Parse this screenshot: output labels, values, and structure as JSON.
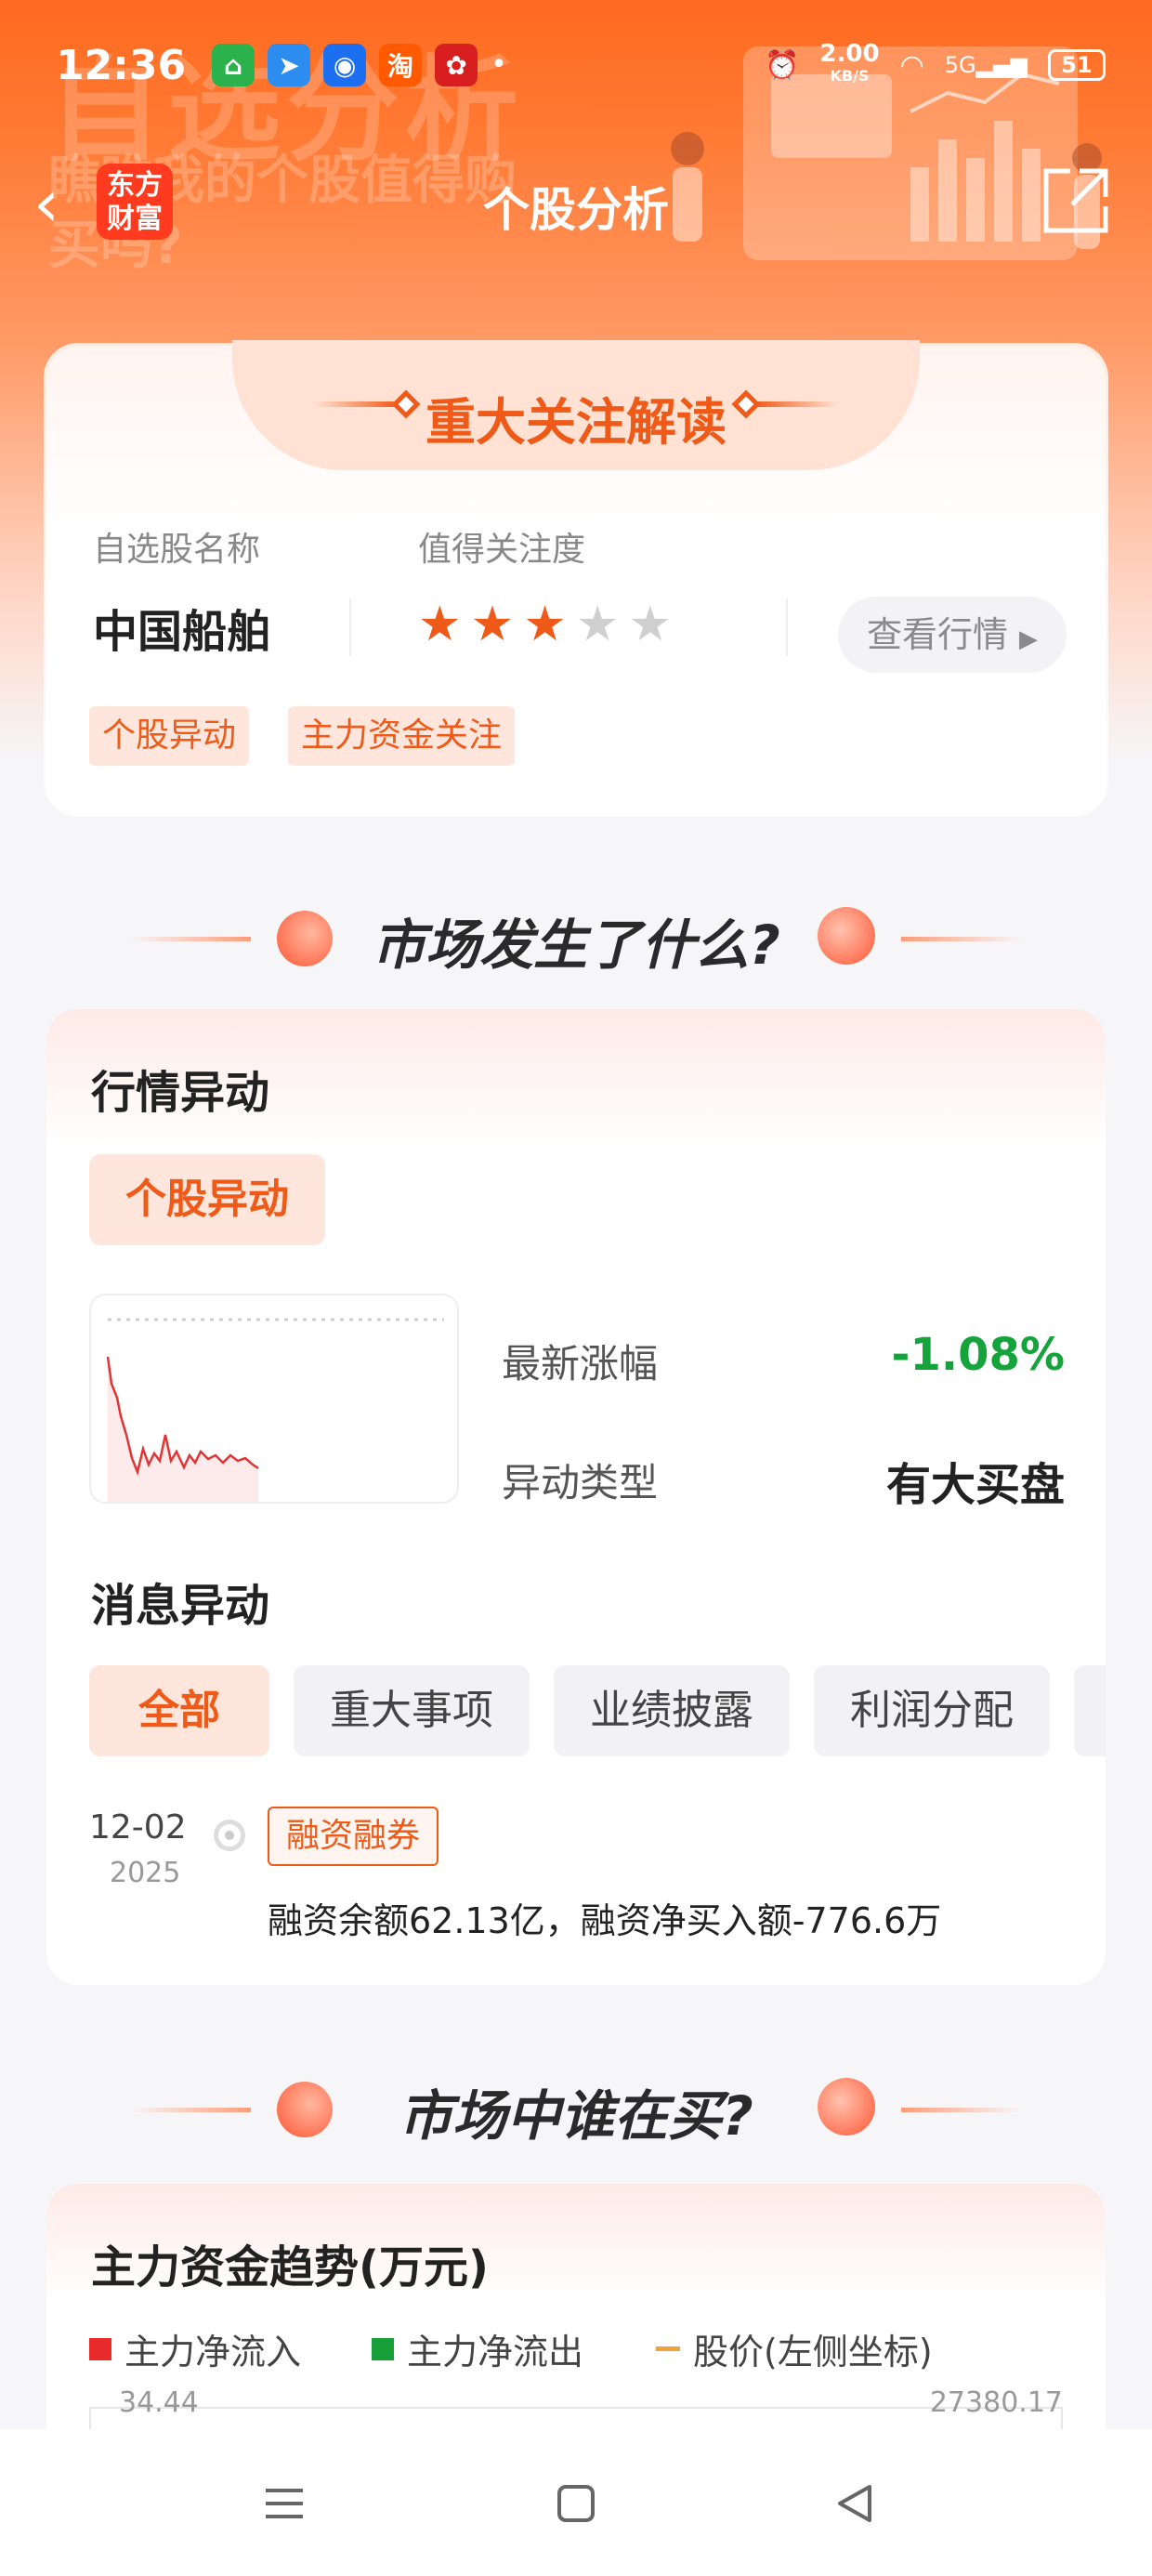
{
  "status_bar": {
    "time": "12:36",
    "net_speed": "2.00",
    "net_unit": "KB/S",
    "battery": "51",
    "signal": "5G"
  },
  "hero": {
    "bg_title": "自选分析",
    "bg_subtitle": "瞧瞧我的个股值得购买吗?"
  },
  "nav": {
    "title": "个股分析",
    "logo_text": "东方财富"
  },
  "focus_card": {
    "title": "重大关注解读",
    "label_name": "自选股名称",
    "label_rating": "值得关注度",
    "stock_name": "中国船舶",
    "rating": 3,
    "rating_max": 5,
    "view_button": "查看行情",
    "tags": [
      "个股异动",
      "主力资金关注"
    ]
  },
  "section1": {
    "title": "市场发生了什么?"
  },
  "market_card": {
    "heading": "行情异动",
    "chip": "个股异动",
    "latest_change_label": "最新涨幅",
    "latest_change_value": "-1.08%",
    "anomaly_type_label": "异动类型",
    "anomaly_type_value": "有大买盘",
    "news_heading": "消息异动",
    "filters": [
      "全部",
      "重大事项",
      "业绩披露",
      "利润分配"
    ],
    "news": {
      "date": "12-02",
      "year": "2025",
      "tag": "融资融券",
      "text": "融资余额62.13亿，融资净买入额-776.6万"
    }
  },
  "section2": {
    "title": "市场中谁在买?"
  },
  "fund_card": {
    "heading": "主力资金趋势(万元)",
    "legend": [
      {
        "label": "主力净流入",
        "color": "#e82a2a"
      },
      {
        "label": "主力净流出",
        "color": "#17a03a"
      },
      {
        "label": "股价(左侧坐标)",
        "color": "#f1a33a"
      }
    ],
    "axis_left_top": "34.44",
    "axis_right_top": "27380.17"
  },
  "colors": {
    "accent": "#ef5a18",
    "positive": "#15a33b"
  }
}
